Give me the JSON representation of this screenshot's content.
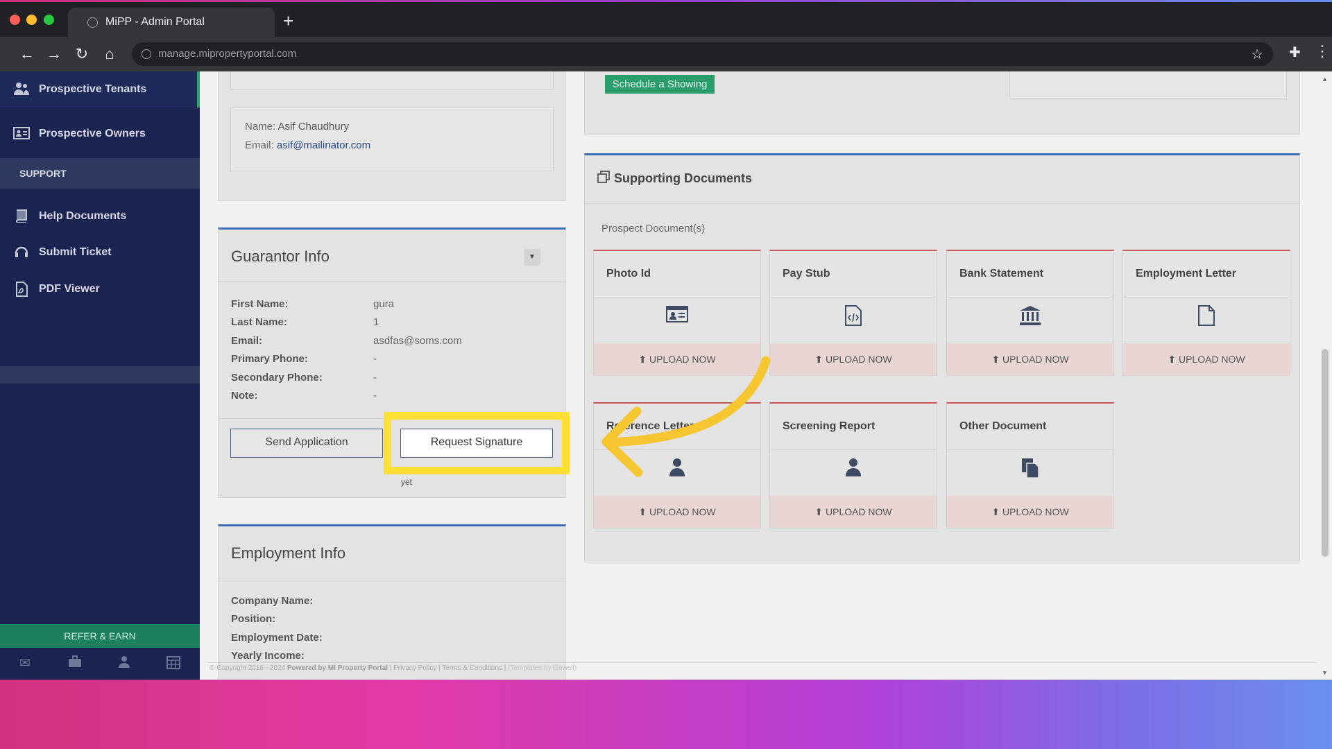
{
  "browser": {
    "tab_title": "MiPP - Admin Portal",
    "url": "manage.mipropertyportal.com"
  },
  "sidebar": {
    "items": [
      {
        "label": "Prospective Tenants",
        "icon": "users-icon"
      },
      {
        "label": "Prospective Owners",
        "icon": "id-card-icon"
      }
    ],
    "section": "SUPPORT",
    "support_items": [
      {
        "label": "Help Documents",
        "icon": "book-icon"
      },
      {
        "label": "Submit Ticket",
        "icon": "headset-icon"
      },
      {
        "label": "PDF Viewer",
        "icon": "pdf-icon"
      }
    ],
    "refer_label": "REFER & EARN"
  },
  "contact": {
    "name_label": "Name:",
    "name_value": "Asif Chaudhury",
    "email_label": "Email:",
    "email_value": "asif@mailinator.com"
  },
  "guarantor": {
    "title": "Guarantor Info",
    "rows": [
      {
        "label": "First Name:",
        "value": "gura"
      },
      {
        "label": "Last Name:",
        "value": "1"
      },
      {
        "label": "Email:",
        "value": "asdfas@soms.com"
      },
      {
        "label": "Primary Phone:",
        "value": "-"
      },
      {
        "label": "Secondary Phone:",
        "value": "-"
      },
      {
        "label": "Note:",
        "value": "-"
      }
    ],
    "send_button": "Send Application",
    "request_button": "Request Signature",
    "note_fragment": "yet"
  },
  "employment": {
    "title": "Employment Info",
    "rows": [
      {
        "label": "Company Name:"
      },
      {
        "label": "Position:"
      },
      {
        "label": "Employment Date:"
      },
      {
        "label": "Yearly Income:"
      }
    ]
  },
  "showing": {
    "button": "Schedule a Showing"
  },
  "documents": {
    "title": "Supporting Documents",
    "subtitle": "Prospect Document(s)",
    "upload_label": "UPLOAD NOW",
    "cards": [
      {
        "title": "Photo Id",
        "icon": "id-card-icon"
      },
      {
        "title": "Pay Stub",
        "icon": "code-file-icon"
      },
      {
        "title": "Bank Statement",
        "icon": "bank-icon"
      },
      {
        "title": "Employment Letter",
        "icon": "file-icon"
      },
      {
        "title": "Reference Letter",
        "icon": "user-icon"
      },
      {
        "title": "Screening Report",
        "icon": "user-icon"
      },
      {
        "title": "Other Document",
        "icon": "files-icon"
      }
    ]
  },
  "footer": {
    "copyright": "© Copyright 2016 - 2024",
    "powered": "Powered by MI Property Portal",
    "links": "| Privacy Policy | Terms & Conditions |",
    "templates": "(Templates by Gowell)"
  },
  "annotation": {
    "highlight_color": "#fde033"
  }
}
